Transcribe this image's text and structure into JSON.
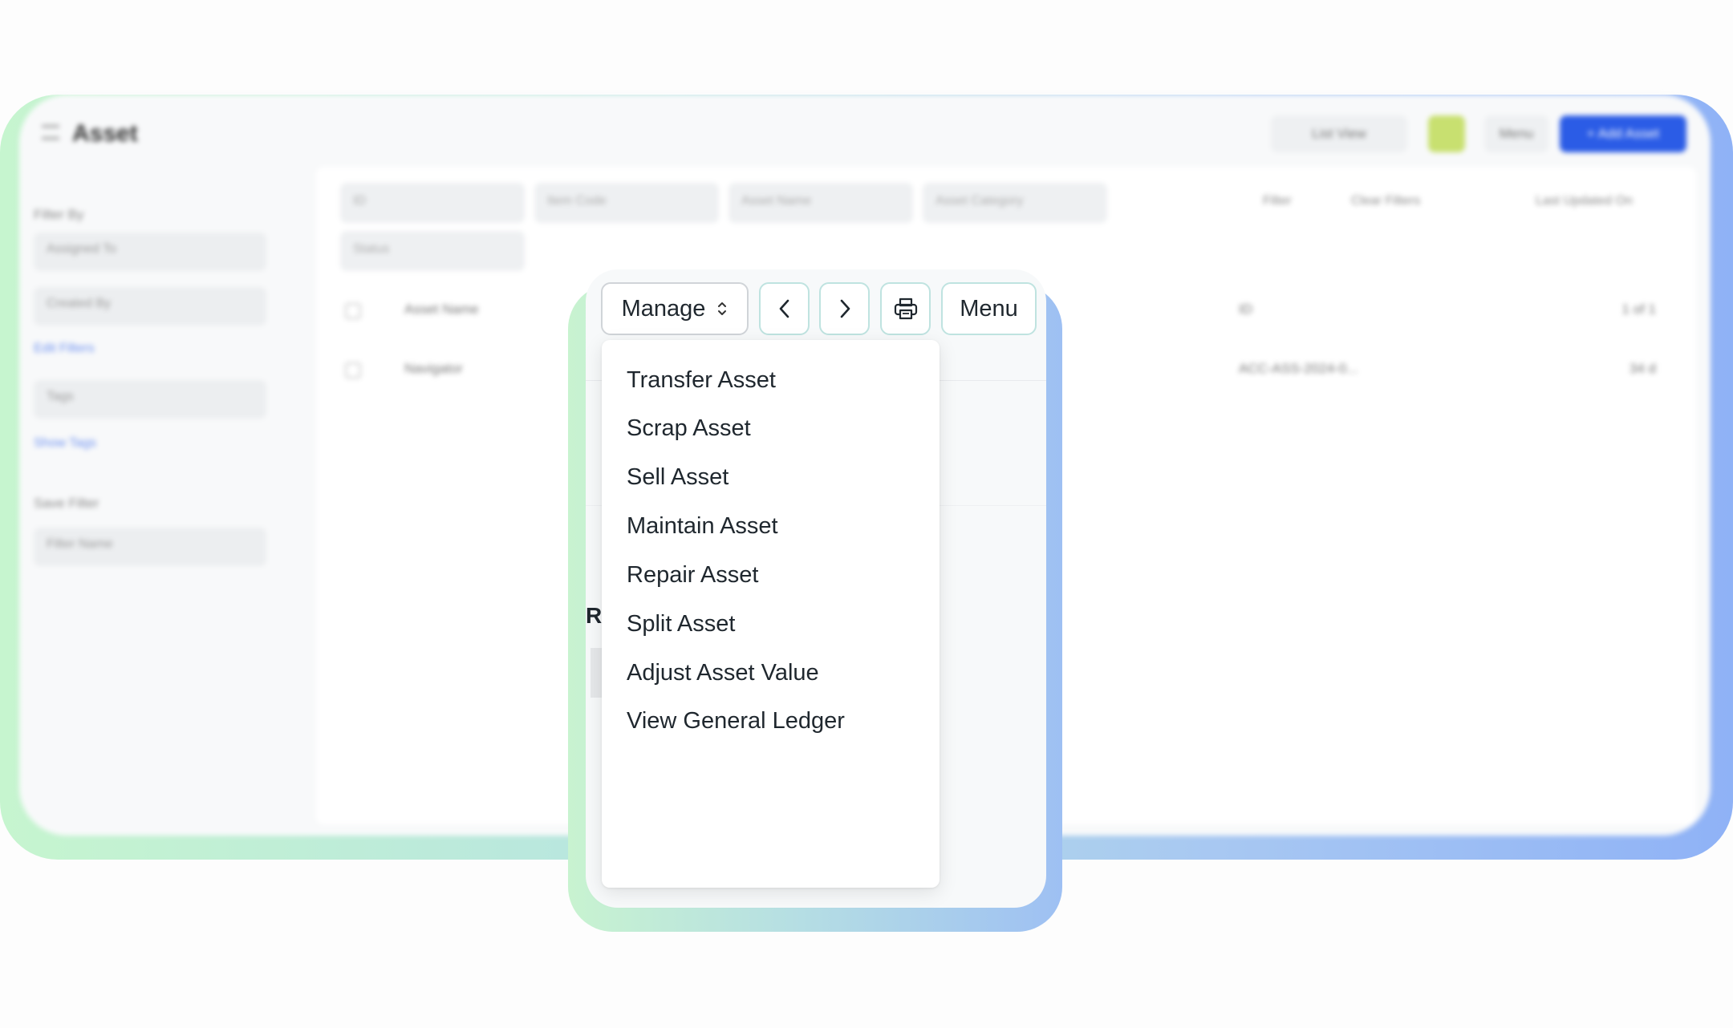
{
  "background": {
    "title": "Asset",
    "list_view_label": "List View",
    "menu_label": "Menu",
    "add_label": "+ Add Asset",
    "sidebar": {
      "filter_by": "Filter By",
      "assigned_to": "Assigned To",
      "created_by": "Created By",
      "edit_filters": "Edit Filters",
      "tags": "Tags",
      "show_tags": "Show Tags",
      "save_filter": "Save Filter",
      "filter_name_placeholder": "Filter Name"
    },
    "filters": {
      "id": "ID",
      "item_code": "Item Code",
      "asset_name": "Asset Name",
      "asset_category": "Asset Category",
      "status": "Status",
      "filter": "Filter",
      "clear_filters": "Clear Filters",
      "sort": "Last Updated On"
    },
    "rows": [
      {
        "name": "Asset Name",
        "mid": "ID",
        "right": "1 of 1"
      },
      {
        "name": "Navigator",
        "mid": "ACC-ASS-2024-0...",
        "right": "34 d"
      }
    ]
  },
  "toolbar": {
    "manage_label": "Manage",
    "menu_label": "Menu"
  },
  "section_heading": "R",
  "dropdown": {
    "items": [
      "Transfer Asset",
      "Scrap Asset",
      "Sell Asset",
      "Maintain Asset",
      "Repair Asset",
      "Split Asset",
      "Adjust Asset Value",
      "View General Ledger"
    ]
  },
  "colors": {
    "primary": "#2b5ce6",
    "frame_green": "#c6f5cf",
    "frame_blue": "#8fb2f6",
    "button_border": "#bfe3e0"
  }
}
